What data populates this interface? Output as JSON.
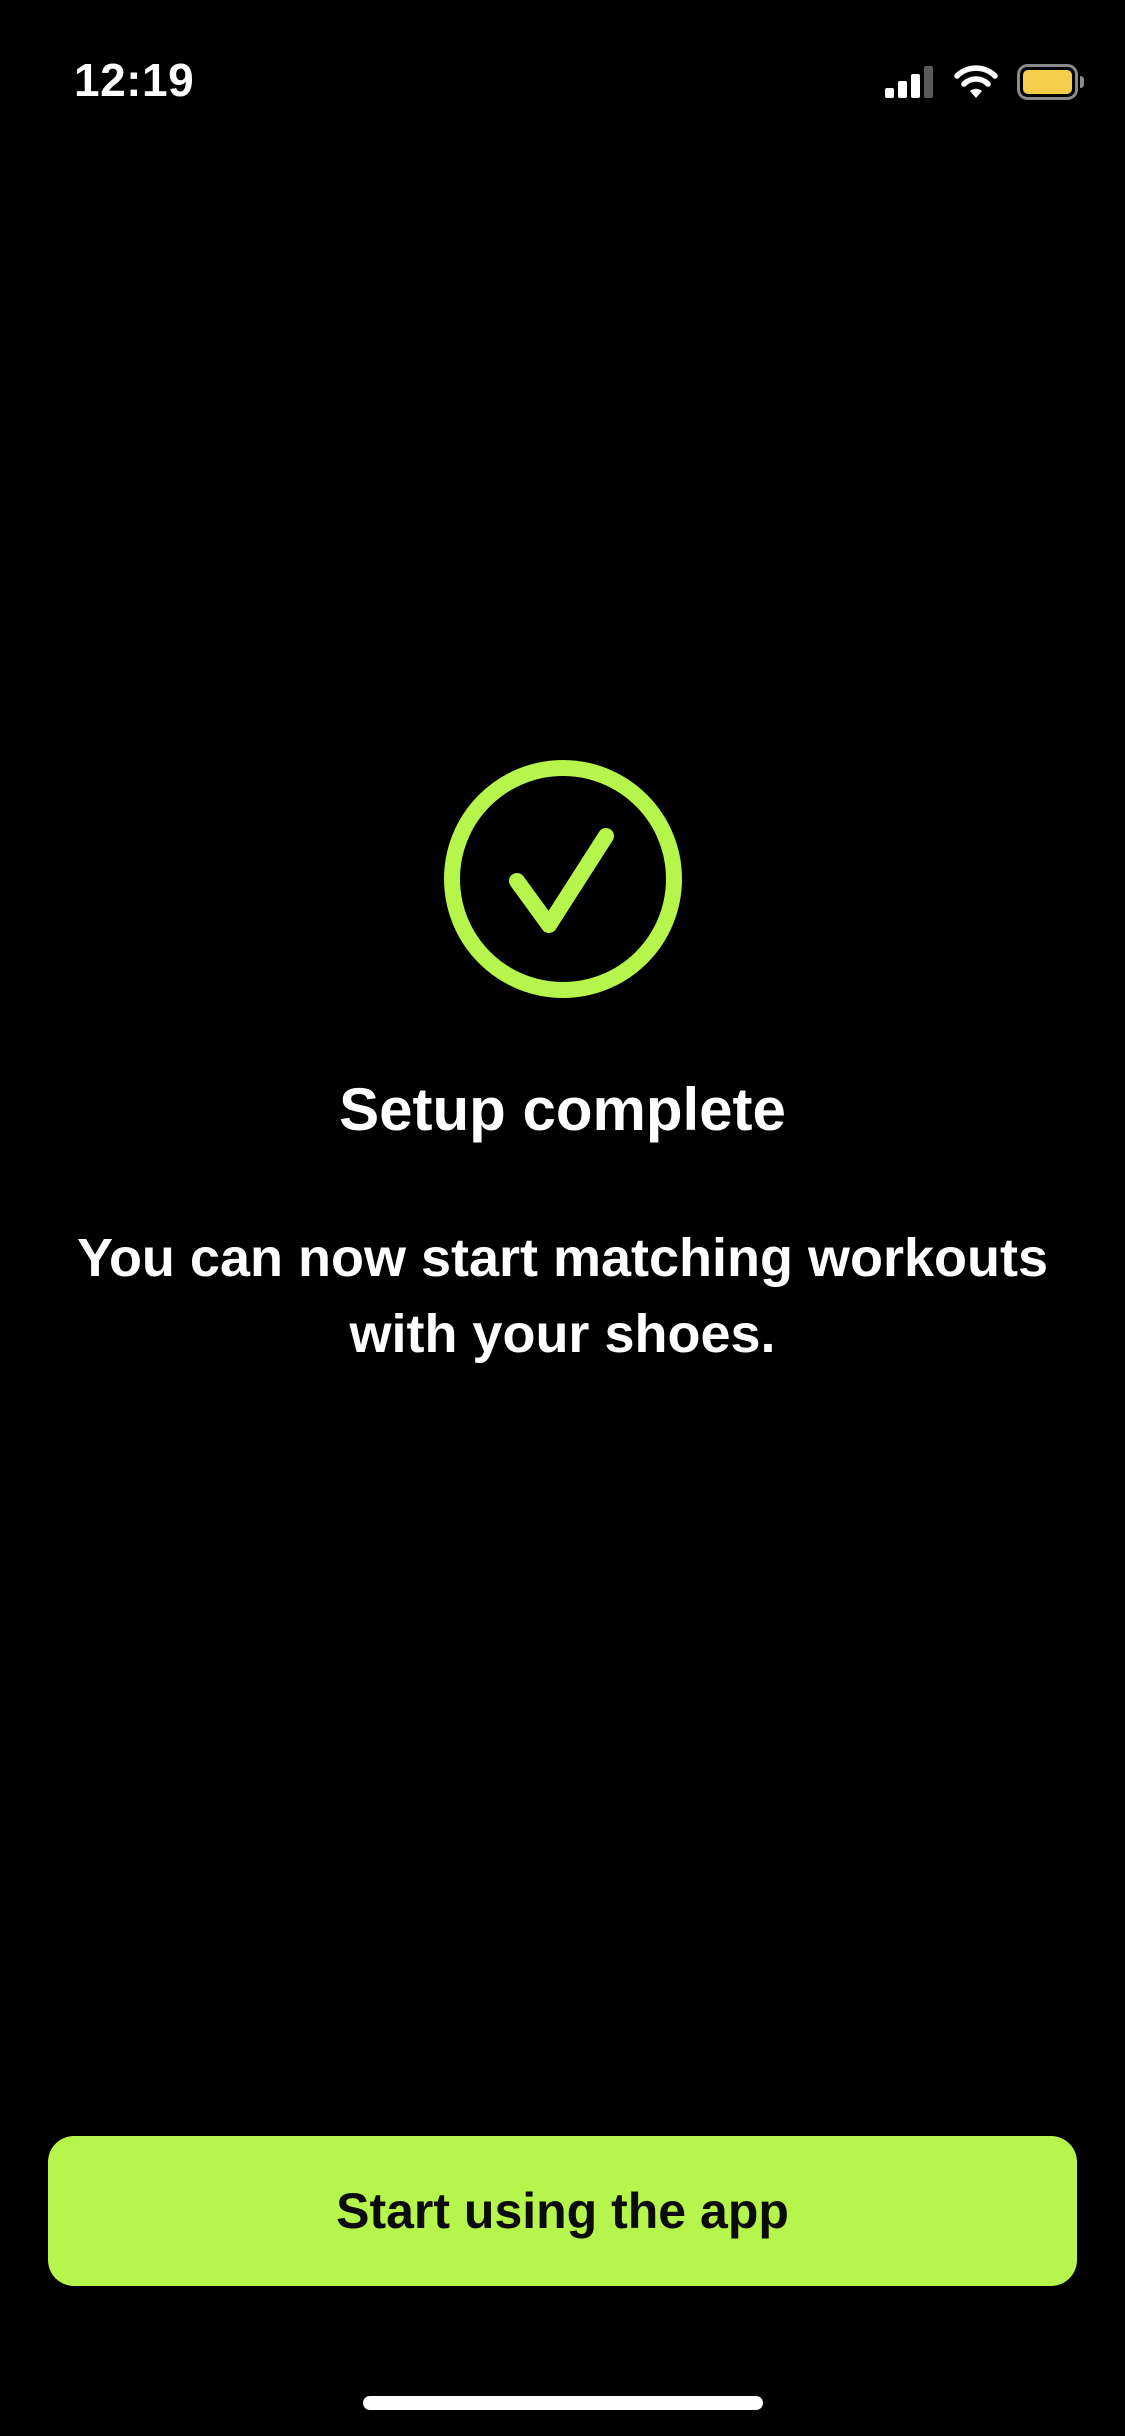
{
  "status_bar": {
    "time": "12:19",
    "icons": [
      "cellular-signal-icon",
      "wifi-icon",
      "battery-icon"
    ],
    "battery_color": "#f4cd4a"
  },
  "main": {
    "icon": "checkmark-circle-icon",
    "accent_color": "#b6f54c",
    "title": "Setup complete",
    "subtitle": "You can now start matching workouts with your shoes."
  },
  "footer": {
    "button_label": "Start using the app"
  }
}
